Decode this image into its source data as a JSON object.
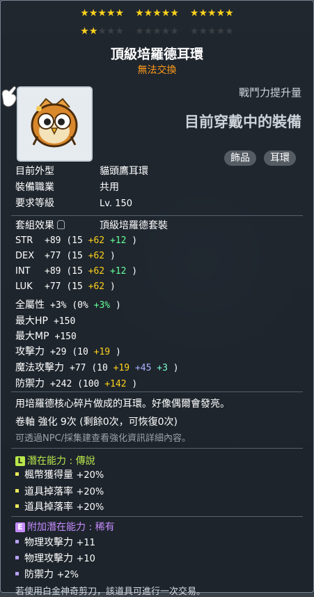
{
  "stars": {
    "row1": [
      5,
      5,
      5
    ],
    "row2": [
      2,
      0,
      0
    ],
    "row1_filled": 15,
    "row2_filled": 2
  },
  "item": {
    "name": "頂級培羅德耳環",
    "trade": "無法交換"
  },
  "combat": {
    "label": "戰鬥力提升量",
    "value": "目前穿戴中的裝備"
  },
  "tags": [
    "飾品",
    "耳環"
  ],
  "info": [
    {
      "label": "目前外型",
      "value": "貓頭鷹耳環"
    },
    {
      "label": "裝備職業",
      "value": "共用"
    },
    {
      "label": "要求等級",
      "value": "Lv. 150"
    }
  ],
  "set": {
    "label": "套組效果",
    "value": "頂級培羅德套裝"
  },
  "stats": [
    {
      "name": "STR",
      "total": "+89",
      "base": "(15",
      "parts": [
        {
          "t": "+62",
          "c": "cy"
        },
        {
          "t": "+12",
          "c": "cg"
        }
      ],
      "close": ")"
    },
    {
      "name": "DEX",
      "total": "+77",
      "base": "(15",
      "parts": [
        {
          "t": "+62",
          "c": "cy"
        }
      ],
      "close": ")"
    },
    {
      "name": "INT",
      "total": "+89",
      "base": "(15",
      "parts": [
        {
          "t": "+62",
          "c": "cy"
        },
        {
          "t": "+12",
          "c": "cg"
        }
      ],
      "close": ")"
    },
    {
      "name": "LUK",
      "total": "+77",
      "base": "(15",
      "parts": [
        {
          "t": "+62",
          "c": "cy"
        }
      ],
      "close": ")"
    },
    {
      "name": "全屬性",
      "total": "+3%",
      "base": "(0%",
      "parts": [
        {
          "t": "+3%",
          "c": "cg"
        }
      ],
      "close": ")"
    },
    {
      "name": "最大HP",
      "total": "+150",
      "base": "",
      "parts": [],
      "close": ""
    },
    {
      "name": "最大MP",
      "total": "+150",
      "base": "",
      "parts": [],
      "close": ""
    },
    {
      "name": "攻擊力",
      "total": "+29",
      "base": "(10",
      "parts": [
        {
          "t": "+19",
          "c": "cy"
        }
      ],
      "close": ")"
    },
    {
      "name": "魔法攻擊力",
      "total": "+77",
      "base": "(10",
      "parts": [
        {
          "t": "+19",
          "c": "cy"
        },
        {
          "t": "+45",
          "c": "cb"
        },
        {
          "t": "+3",
          "c": "cgreen"
        }
      ],
      "close": ")"
    },
    {
      "name": "防禦力",
      "total": "+242",
      "base": "(100",
      "parts": [
        {
          "t": "+142",
          "c": "cy"
        }
      ],
      "close": ")"
    }
  ],
  "description": {
    "line1": "用培羅德核心碎片做成的耳環。好像偶爾會發亮。",
    "line2": "卷軸 強化 9次 (剩餘0次，可恢復0次)",
    "line3": "可透過NPC/採集建查看強化資訊詳細內容。"
  },
  "potential": {
    "badge": "L",
    "title": "潛在能力 : 傳說",
    "lines": [
      {
        "name": "楓幣獲得量",
        "value": "+20%"
      },
      {
        "name": "道具掉落率",
        "value": "+20%"
      },
      {
        "name": "道具掉落率",
        "value": "+20%"
      }
    ]
  },
  "bonus": {
    "badge": "E",
    "title": "附加潛在能力 : 稀有",
    "lines": [
      {
        "name": "物理攻擊力",
        "value": "+11"
      },
      {
        "name": "物理攻擊力",
        "value": "+10"
      },
      {
        "name": "防禦力",
        "value": "+2%"
      }
    ]
  },
  "footer": "若使用白金神奇剪刀，該道具可進行一次交易。",
  "colors": {
    "star_on": "#ffd21c",
    "trade": "#ff9a1a",
    "legend": "#b8e84a",
    "rare": "#c68cff"
  }
}
